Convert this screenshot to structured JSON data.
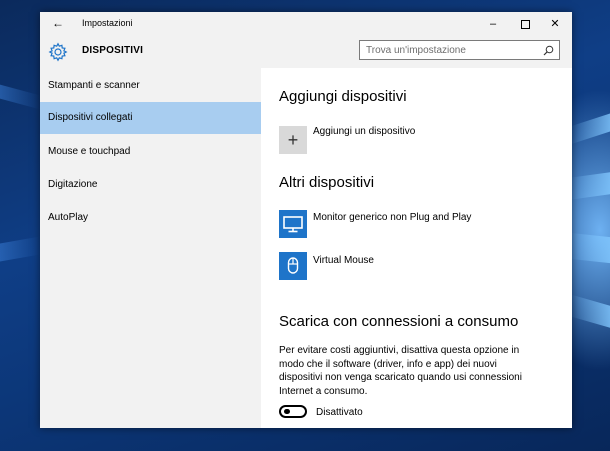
{
  "window": {
    "app_title": "Impostazioni",
    "back_label": "←",
    "minimize_label": "–",
    "close_label": "✕"
  },
  "header": {
    "section_title": "DISPOSITIVI",
    "search_placeholder": "Trova un'impostazione"
  },
  "sidebar": {
    "items": [
      {
        "label": "Stampanti e scanner",
        "selected": false
      },
      {
        "label": "Dispositivi collegati",
        "selected": true
      },
      {
        "label": "Mouse e touchpad",
        "selected": false
      },
      {
        "label": "Digitazione",
        "selected": false
      },
      {
        "label": "AutoPlay",
        "selected": false
      }
    ]
  },
  "main": {
    "add_heading": "Aggiungi dispositivi",
    "add_device_label": "Aggiungi un dispositivo",
    "add_icon": "+",
    "other_heading": "Altri dispositivi",
    "devices": [
      {
        "label": "Monitor generico non Plug and Play",
        "icon": "monitor-icon"
      },
      {
        "label": "Virtual Mouse",
        "icon": "mouse-icon"
      }
    ],
    "metered_heading": "Scarica con connessioni a consumo",
    "metered_description": "Per evitare costi aggiuntivi, disattiva questa opzione in modo che il software (driver, info e app) dei nuovi dispositivi non venga scaricato quando usi connessioni Internet a consumo.",
    "toggle_state_label": "Disattivato",
    "toggle_on": false
  },
  "colors": {
    "accent": "#1e74c9",
    "selected_nav": "#a8cdf0",
    "chrome": "#f2f2f2"
  }
}
